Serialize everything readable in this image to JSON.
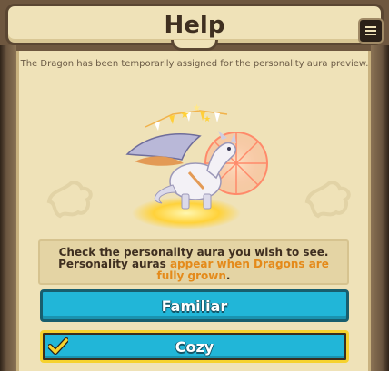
{
  "header": {
    "title": "Help"
  },
  "notice": "The Dragon has been temporarily assigned for the personality aura preview.",
  "info": {
    "line1": "Check the personality aura you wish to see.",
    "line2_part1": "Personality auras ",
    "line2_highlight": "appear when Dragons are fully grown",
    "line2_end": "."
  },
  "options": [
    {
      "label": "Familiar",
      "selected": false
    },
    {
      "label": "Cozy",
      "selected": true
    }
  ],
  "colors": {
    "button_fill": "#21b6d8",
    "selected_border": "#f6d22e",
    "highlight_text": "#e48a1a",
    "panel": "#efe2b8"
  },
  "icons": [
    "menu-icon",
    "checkmark-icon",
    "dragon-icon"
  ]
}
